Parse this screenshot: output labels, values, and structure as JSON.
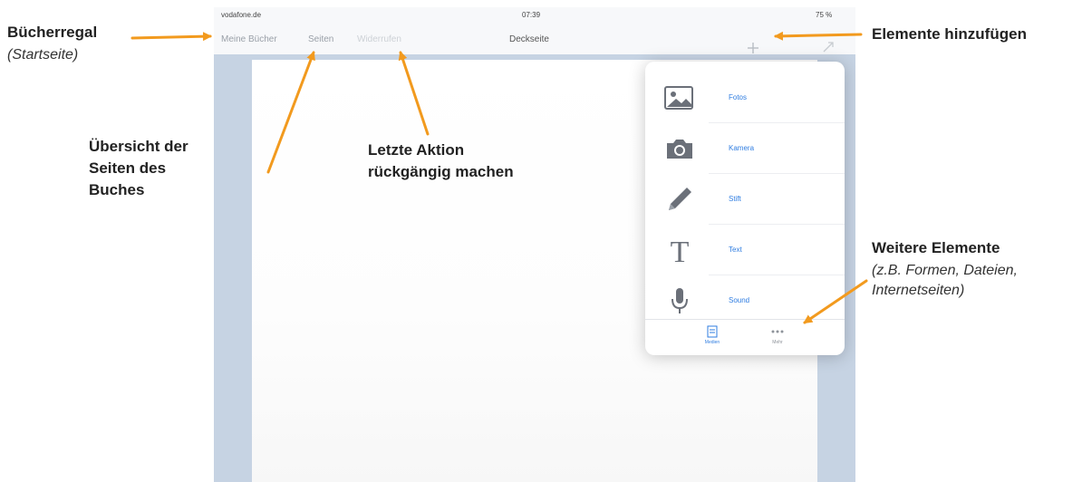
{
  "ipad": {
    "status": {
      "carrier": "vodafone.de",
      "time": "07:39",
      "battery": "75 %"
    },
    "nav": {
      "my_books": "Meine Bücher",
      "pages": "Seiten",
      "undo": "Widerrufen",
      "title": "Deckseite"
    },
    "popover": {
      "items": [
        {
          "label": "Fotos",
          "icon": "photo-icon"
        },
        {
          "label": "Kamera",
          "icon": "camera-icon"
        },
        {
          "label": "Stift",
          "icon": "pencil-icon"
        },
        {
          "label": "Text",
          "icon": "text-icon"
        },
        {
          "label": "Sound",
          "icon": "microphone-icon"
        }
      ],
      "tabs": [
        {
          "label": "Medien",
          "icon": "media-tab-icon"
        },
        {
          "label": "Mehr",
          "icon": "more-icon"
        }
      ]
    },
    "accent": "#2f7de1"
  },
  "annotations": {
    "bookshelf": {
      "title": "Bücherregal",
      "subtitle": "Startseite"
    },
    "overview": [
      "Übersicht der",
      "Seiten des",
      "Buches"
    ],
    "undo": [
      "Letzte Aktion",
      "rückgängig machen"
    ],
    "add": "Elemente hinzufügen",
    "more": {
      "title": "Weitere Elemente",
      "lines": [
        "(z.B. Formen, Dateien,",
        "Internetseiten)"
      ]
    },
    "arrow_color": "#f29a1e"
  }
}
